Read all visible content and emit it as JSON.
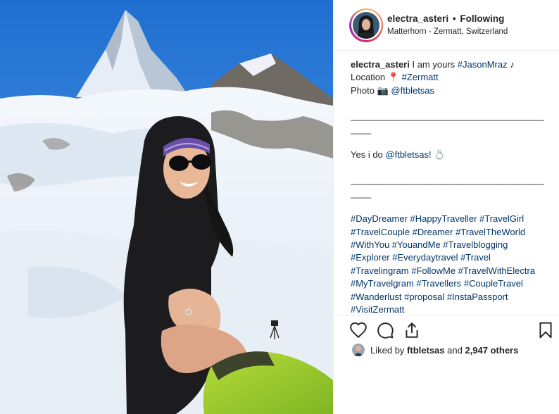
{
  "header": {
    "username": "electra_asteri",
    "separator": "•",
    "follow_status": "Following",
    "location": "Matterhorn - Zermatt, Switzerland",
    "avatar_icon": "profile-avatar"
  },
  "caption": {
    "username": "electra_asteri",
    "line1_text": "I am yours",
    "line1_tag": "#JasonMraz",
    "line1_emoji": "♪",
    "location_label": "Location",
    "location_emoji": "📍",
    "location_tag": "#Zermatt",
    "photo_label": "Photo",
    "photo_emoji": "📷",
    "photo_tag": "@ftbletsas",
    "separator1": "__________________________________________",
    "yes_text": "Yes i do",
    "yes_tag": "@ftbletsas!",
    "yes_emoji": "💍",
    "separator2": "__________________________________________",
    "hashtags": "#DayDreamer #HappyTraveller #TravelGirl #TravelCouple  #Dreamer #TravelTheWorld #WithYou #YouandMe #Travelblogging #Explorer #Everydaytravel  #Travel #Travelingram #FollowMe #TravelWithElectra #MyTravelgram #Travellers #CoupleTravel #Wanderlust #proposal #InstaPassport #VisitZermatt"
  },
  "actions": {
    "like_icon": "heart-outline",
    "comment_icon": "comment-bubble",
    "share_icon": "share-upload",
    "save_icon": "bookmark-outline"
  },
  "likes": {
    "prefix": "Liked by",
    "user": "ftbletsas",
    "middle": "and",
    "count": "2,947 others"
  },
  "colors": {
    "tag": "#003569",
    "text": "#262626",
    "border": "#efefef"
  }
}
